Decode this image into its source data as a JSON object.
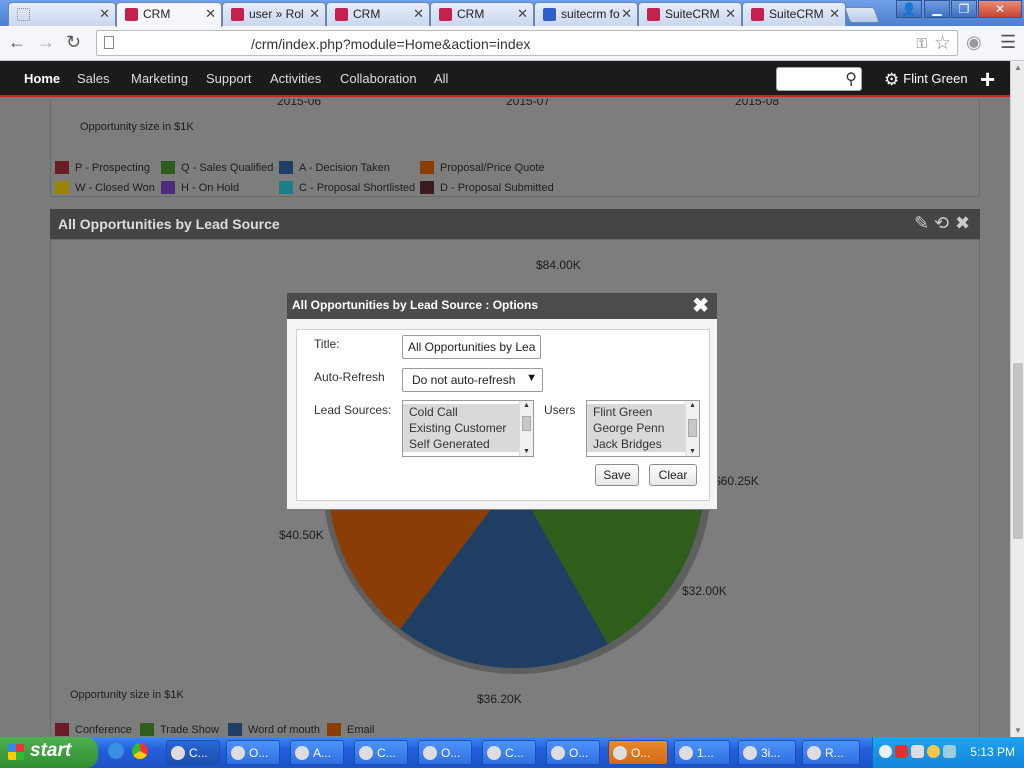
{
  "browser": {
    "tabs": [
      {
        "label": "",
        "favicon": "blank"
      },
      {
        "label": "CRM",
        "favicon": "suitecrm"
      },
      {
        "label": "user » Rol",
        "favicon": "suitecrm"
      },
      {
        "label": "CRM",
        "favicon": "suitecrm"
      },
      {
        "label": "CRM",
        "favicon": "suitecrm"
      },
      {
        "label": "suitecrm fo",
        "favicon": "google"
      },
      {
        "label": "SuiteCRM",
        "favicon": "suitecrm"
      },
      {
        "label": "SuiteCRM",
        "favicon": "suitecrm"
      }
    ],
    "url": "/crm/index.php?module=Home&action=index"
  },
  "navbar": {
    "items": [
      "Home",
      "Sales",
      "Marketing",
      "Support",
      "Activities",
      "Collaboration",
      "All"
    ],
    "user": "Flint Green"
  },
  "top_chart": {
    "months": [
      "2015-06",
      "2015-07",
      "2015-08"
    ],
    "footnote": "Opportunity size in $1K",
    "legend": [
      {
        "label": "P - Prospecting",
        "color": "#6a1d24"
      },
      {
        "label": "Q - Sales Qualified",
        "color": "#2f5d1c"
      },
      {
        "label": "A - Decision Taken",
        "color": "#1e3f63"
      },
      {
        "label": "Proposal/Price Quote",
        "color": "#8a3e06"
      },
      {
        "label": "W - Closed Won",
        "color": "#9a8404"
      },
      {
        "label": "H - On Hold",
        "color": "#4d2a7a"
      },
      {
        "label": "C - Proposal Shortlisted",
        "color": "#1a7f86"
      },
      {
        "label": "D - Proposal Submitted",
        "color": "#3a1c1c"
      }
    ]
  },
  "dashlet": {
    "title": "All Opportunities by Lead Source",
    "pie_labels": [
      "$84.00K",
      "$60.25K",
      "$32.00K",
      "$36.20K",
      "$40.50K"
    ],
    "footnote": "Opportunity size in $1K",
    "legend": [
      {
        "label": "Conference",
        "color": "#6a1d24"
      },
      {
        "label": "Trade Show",
        "color": "#2f5d1c"
      },
      {
        "label": "Word of mouth",
        "color": "#1e3f63"
      },
      {
        "label": "Email",
        "color": "#8a3e06"
      }
    ]
  },
  "modal": {
    "title": "All Opportunities by Lead Source : Options",
    "title_label": "Title:",
    "title_value": "All Opportunities by Lea",
    "refresh_label": "Auto-Refresh",
    "refresh_value": "Do not auto-refresh",
    "lead_sources_label": "Lead Sources:",
    "lead_sources": [
      "Cold Call",
      "Existing Customer",
      "Self Generated"
    ],
    "users_label": "Users",
    "users": [
      "Flint Green",
      "George Penn",
      "Jack Bridges"
    ],
    "save_label": "Save",
    "clear_label": "Clear"
  },
  "taskbar": {
    "start_label": "start",
    "items": [
      "C...",
      "O...",
      "A...",
      "C...",
      "O...",
      "C...",
      "O...",
      "O...",
      "1...",
      "3i...",
      "R..."
    ],
    "clock": "5:13 PM"
  }
}
